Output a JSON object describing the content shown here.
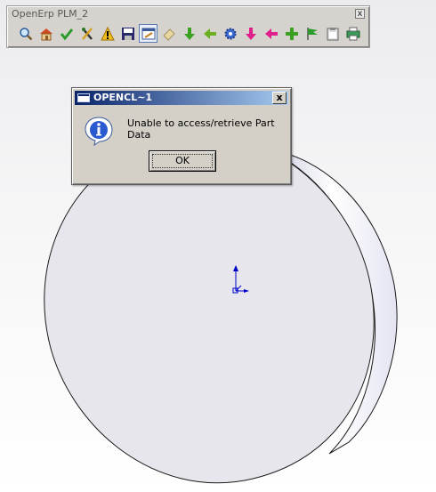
{
  "toolbar": {
    "title": "OpenErp PLM_2",
    "close_label": "x",
    "buttons": [
      {
        "icon": "search-icon"
      },
      {
        "icon": "home-icon"
      },
      {
        "icon": "checkmark-icon"
      },
      {
        "icon": "tools-icon"
      },
      {
        "icon": "warning-icon"
      },
      {
        "icon": "save-icon"
      },
      {
        "icon": "edit-window-icon"
      },
      {
        "icon": "eraser-icon"
      },
      {
        "icon": "arrow-down-green-icon"
      },
      {
        "icon": "arrow-left-green-icon"
      },
      {
        "icon": "gear-icon"
      },
      {
        "icon": "arrow-down-magenta-icon"
      },
      {
        "icon": "arrow-left-magenta-icon"
      },
      {
        "icon": "plus-icon"
      },
      {
        "icon": "flag-icon"
      },
      {
        "icon": "clipboard-icon"
      },
      {
        "icon": "printer-icon"
      }
    ]
  },
  "dialog": {
    "title": "OPENCL~1",
    "close_label": "x",
    "message": "Unable to access/retrieve Part Data",
    "ok_label": "OK",
    "icon": "info-icon"
  }
}
